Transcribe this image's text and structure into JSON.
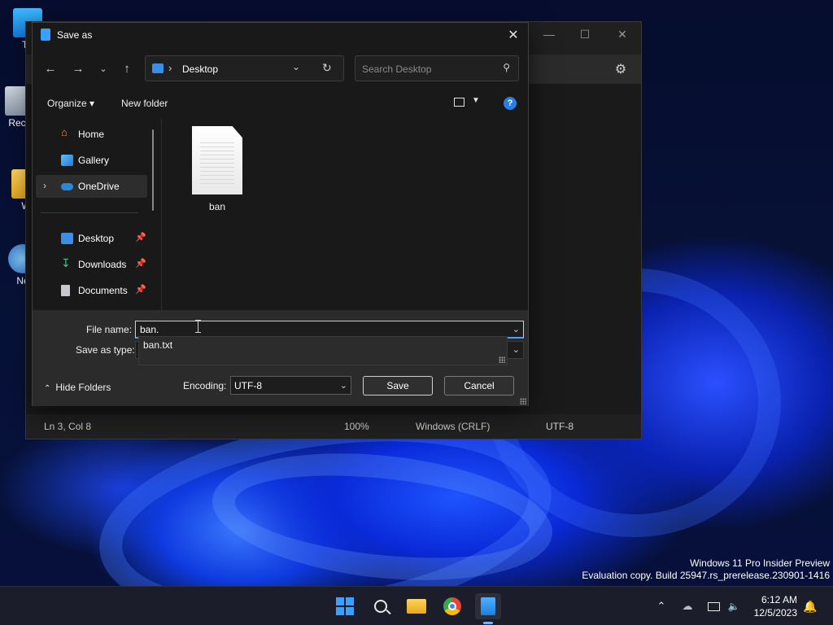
{
  "desktop": {
    "icons": [
      {
        "label": "Th"
      },
      {
        "label": "Recy"
      },
      {
        "label": "W"
      },
      {
        "label": "Ne"
      }
    ],
    "watermark_line1": "Windows 11 Pro Insider Preview",
    "watermark_line2": "Evaluation copy. Build 25947.rs_prerelease.230901-1416"
  },
  "notepad": {
    "status": {
      "position": "Ln 3, Col 8",
      "zoom": "100%",
      "line_ending": "Windows (CRLF)",
      "encoding": "UTF-8"
    }
  },
  "dialog": {
    "title": "Save as",
    "address": {
      "path": "Desktop",
      "separator": "›"
    },
    "search_placeholder": "Search Desktop",
    "commands": {
      "organize": "Organize ▾",
      "new_folder": "New folder"
    },
    "nav_items": [
      {
        "label": "Home"
      },
      {
        "label": "Gallery"
      },
      {
        "label": "OneDrive"
      },
      {
        "label": "Desktop"
      },
      {
        "label": "Downloads"
      },
      {
        "label": "Documents"
      }
    ],
    "files": [
      {
        "name": "ban"
      }
    ],
    "file_name_label": "File name:",
    "file_name_value": "ban.",
    "save_type_label": "Save as type:",
    "suggestion": "ban.txt",
    "hide_folders": "Hide Folders",
    "encoding_label": "Encoding:",
    "encoding_value": "UTF-8",
    "save_button": "Save",
    "cancel_button": "Cancel"
  },
  "taskbar": {
    "time": "6:12 AM",
    "date": "12/5/2023"
  },
  "colors": {
    "accent": "#4aa0ff",
    "help": "#2a7de1",
    "folder_blue": "#3a8ee6"
  }
}
